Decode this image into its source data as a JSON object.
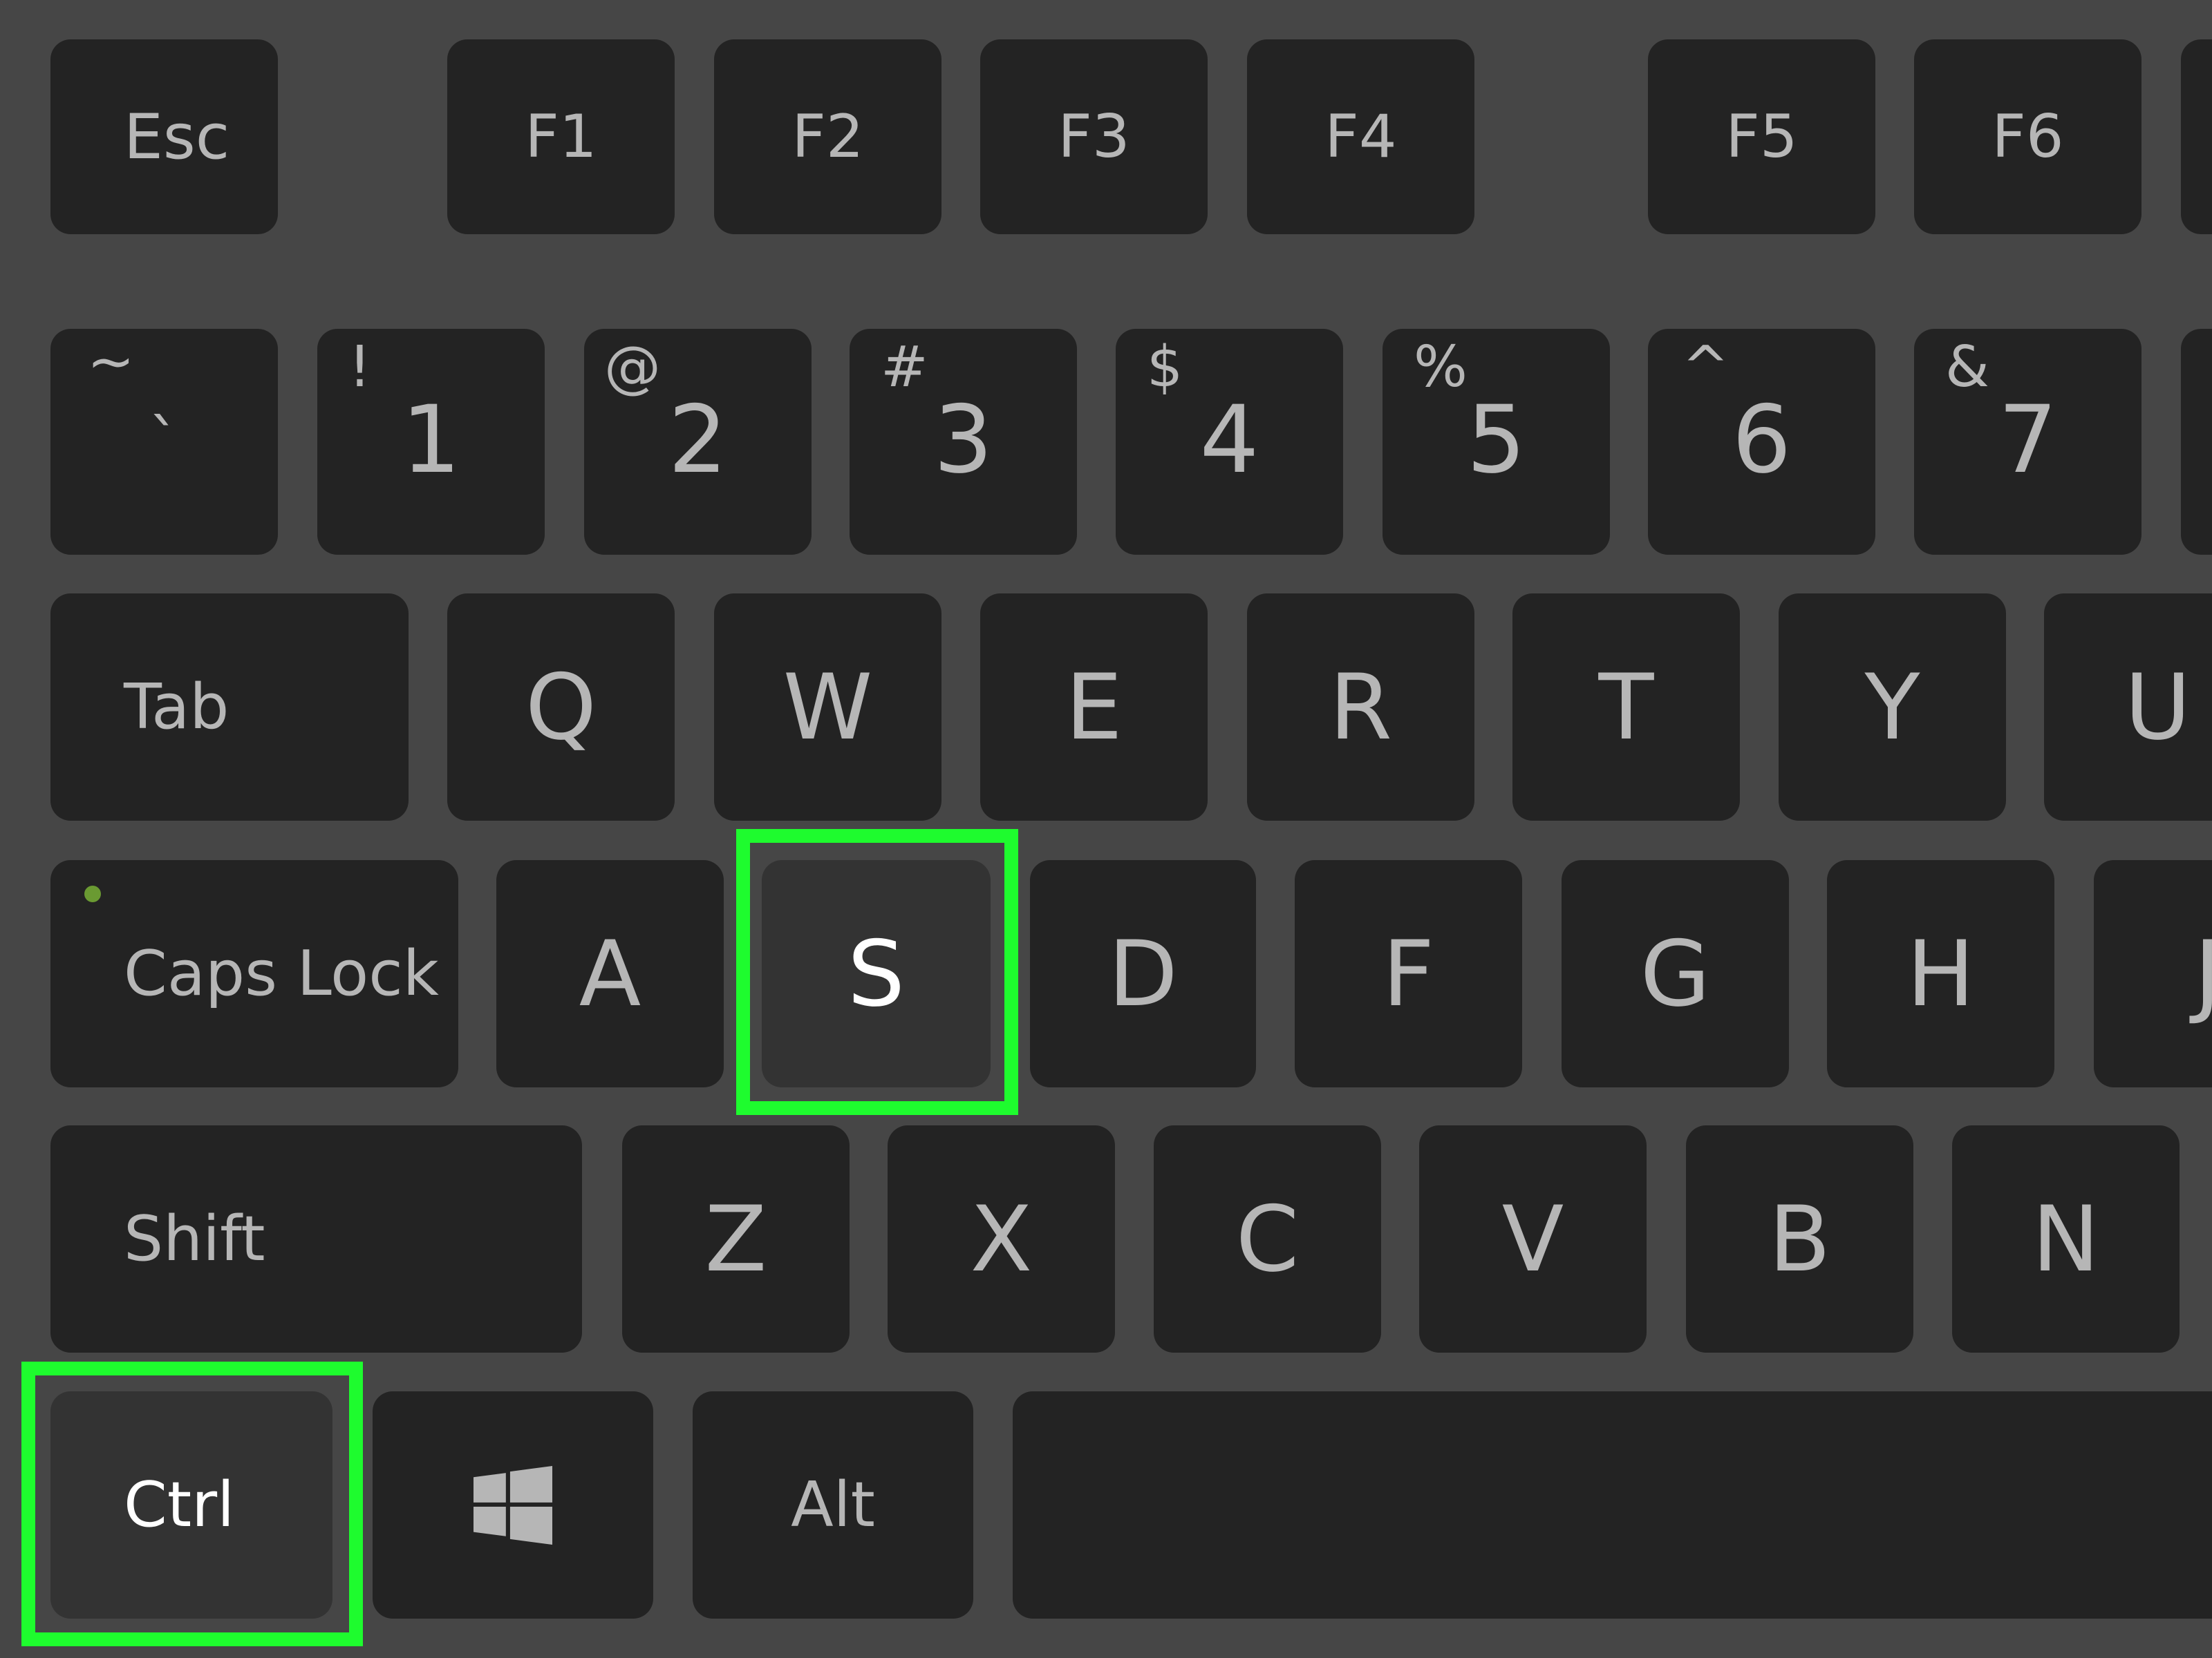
{
  "colors": {
    "background": "#464646",
    "key": "#232323",
    "key_pressed": "#333333",
    "highlight": "#1efc2e",
    "label": "#b6b6b6",
    "caps_lock_led": "#6a9a32"
  },
  "row_function": [
    "Esc",
    "F1",
    "F2",
    "F3",
    "F4",
    "F5",
    "F6"
  ],
  "row_number": [
    {
      "shift": "~",
      "main": "`"
    },
    {
      "shift": "!",
      "main": "1"
    },
    {
      "shift": "@",
      "main": "2"
    },
    {
      "shift": "#",
      "main": "3"
    },
    {
      "shift": "$",
      "main": "4"
    },
    {
      "shift": "%",
      "main": "5"
    },
    {
      "shift": "^",
      "main": "6"
    },
    {
      "shift": "&",
      "main": "7"
    }
  ],
  "row_top": [
    "Tab",
    "Q",
    "W",
    "E",
    "R",
    "T",
    "Y",
    "U"
  ],
  "row_home": [
    "Caps Lock",
    "A",
    "S",
    "D",
    "F",
    "G",
    "H",
    "J"
  ],
  "row_bottom": [
    "Shift",
    "Z",
    "X",
    "C",
    "V",
    "B",
    "N"
  ],
  "row_space": {
    "ctrl": "Ctrl",
    "windows_icon": "windows-logo",
    "alt": "Alt"
  },
  "highlighted_keys": [
    "S",
    "Ctrl"
  ]
}
